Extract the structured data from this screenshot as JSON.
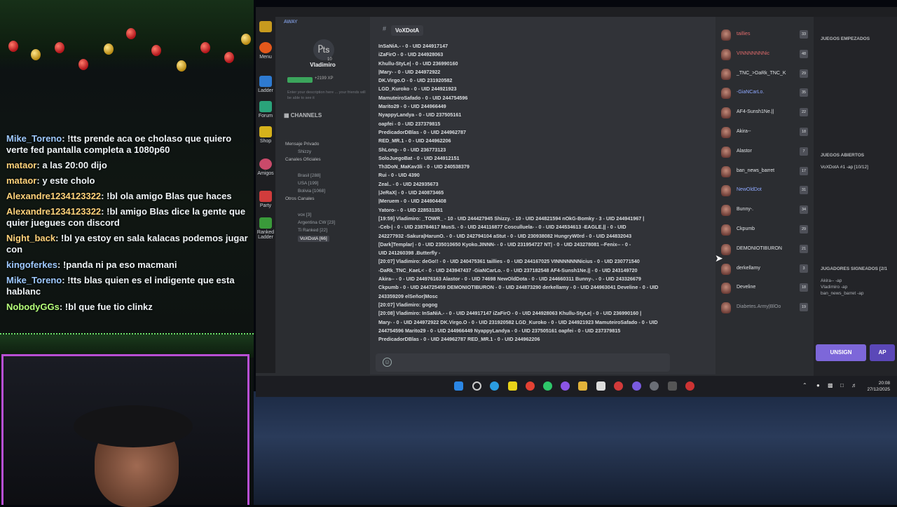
{
  "chat": [
    {
      "user": "Mike_Toreno",
      "color": "#9ec9ff",
      "text": "!tts prende aca oe cholaso que quiero verte fed pantalla completa a 1080p60"
    },
    {
      "user": "mataor",
      "color": "#ffd27a",
      "text": "a las 20:00 dijo"
    },
    {
      "user": "mataor",
      "color": "#ffd27a",
      "text": "y este cholo"
    },
    {
      "user": "Alexandre1234123322",
      "color": "#ffd27a",
      "text": "!bl ola amigo Blas que haces"
    },
    {
      "user": "Alexandre1234123322",
      "color": "#ffd27a",
      "text": "!bl amigo Blas dice la gente que quier juegues con discord"
    },
    {
      "user": "Night_back",
      "color": "#ffd27a",
      "text": "!bl ya estoy en sala kalacas podemos jugar con"
    },
    {
      "user": "kingoferkes",
      "color": "#9ec9ff",
      "text": "!panda ni pa eso macmani"
    },
    {
      "user": "Mike_Toreno",
      "color": "#9ec9ff",
      "text": "!tts blas quien es el indigente que esta hablanc"
    },
    {
      "user": "NobodyGGs",
      "color": "#b6ff7a",
      "text": "!bl que fue tio clinkz"
    }
  ],
  "app": {
    "status": "AWAY",
    "level": "10",
    "username": "Vladimiro",
    "xp": "+2199 XP",
    "description": "Enter your description here ... your friends will be able to see it",
    "channels_label": "CHANNELS",
    "sidebar": [
      "Menu",
      "Ladder",
      "Forum",
      "Shop",
      "Amigos",
      "Party",
      "Ranked Ladder"
    ],
    "tree": [
      {
        "label": "Mensaje Privado",
        "sub": false
      },
      {
        "label": "Shizzy",
        "sub": true
      },
      {
        "label": "Canales Oficiales",
        "sub": false
      },
      {
        "label": "Brasil [288]",
        "sub": true
      },
      {
        "label": "USA [199]",
        "sub": true
      },
      {
        "label": "Bolivia [1068]",
        "sub": true
      },
      {
        "label": "Otros Canales",
        "sub": false
      },
      {
        "label": "vox [3]",
        "sub": true
      },
      {
        "label": "Argentina CW [23]",
        "sub": true
      },
      {
        "label": "Ti Ranked [22]",
        "sub": true
      },
      {
        "label": "VoXDotA [66]",
        "sub": true,
        "selected": true
      }
    ],
    "channel_name": "VoXDotA",
    "messages": [
      "InSaNiA.- - 0 - UID 244917147",
      "iZaFirO - 0 - UID 244928063",
      "Khullu-StyLe| - 0 - UID 236990160",
      "|Mary- - 0 - UID 244972922",
      "DK.Virgo.O - 0 - UID 231920582",
      "LGD_Kuroko - 0 - UID 244921923",
      "MamuteiroSafado - 0 - UID 244754596",
      "Marito29 - 0 - UID 244966449",
      "NyappyLandya - 0 - UID 237505161",
      "oapfei - 0 - UID 237379815",
      "PredicadorDBlas - 0 - UID 244962787",
      "RED_MR.1 - 0 - UID 244962206",
      "ShLong- - 0 - UID 236773123",
      "SoloJuegoBat - 0 - UID 244912151",
      "Th3DoN_MaKav3li - 0 - UID 240538379",
      "Rui - 0 - UID 4390",
      "Zeal.. - 0 - UID 242935673",
      "|JeRaX| - 0 - UID 240873465",
      "|Meruem - 0 - UID 244904408",
      "Yatoro- - 0 - UID 228531351",
      "[19:59] Vladimiro: _TOWR_ - 10 - UID 244427945 Shizzy. - 10 - UID 244821594 nOkG-Bomky - 3 - UID 244941967 |",
      "-Ceb-| - 0 - UID 238784617 MusS. - 0 - UID 244116877 Cosculluela- - 0 - UID 244534613 -EAGLE.|| - 0 - UID",
      "242277932 -Sakura|HarunO. - 0 - UID 242794104 aStut - 0 - UID 230938082 HungryW0rd - 0 - UID 244832043",
      "[Dark]Templar| - 0 - UID 235010650 Kyoko.JINNN- - 0 - UID 231954727 NT| - 0 - UID 243278081 --Fenix-- - 0 -",
      "UID 241260398 .Butterfly -",
      "[20:07] Vladimiro: deGo!! - 0 - UID 240475361 taillies - 0 - UID 244167025 VINNNNNNNicius - 0 - UID 230771540",
      "-DaRk_TNC_KaeL< - 0 - UID 243947437 -GiaNCarLo. - 0 - UID 237182548 AF4-Sunsh1Ne.|| - 0 - UID 243149720",
      "Akira-- - 0 - UID 244976163 Alastor - 0 - UID 74698 NewOldDota - 0 - UID 244660311 Bunny-. - 0 - UID 243326679",
      "Ckpumb - 0 - UID 244725459 DEMONIOTIBURON - 0 - UID 244873290 derkellamy - 0 - UID 244963041 Develine - 0 - UID",
      "243359209 elSeñor|Mosc",
      "[20:07] Vladimiro: gogog",
      "[20:08] Vladimiro: InSaNiA.- - 0 - UID 244917147 iZaFirO - 0 - UID 244928063 Khullu-StyLe| - 0 - UID 236990160 |",
      "Mary- - 0 - UID 244972922 DK.Virgo.O - 0 - UID 231920582 LGD_Kuroko - 0 - UID 244921923 MamuteiroSafado - 0 - UID",
      "244754596 Marito29 - 0 - UID 244966449 NyappyLandya - 0 - UID 237505161 oapfei - 0 - UID 237379815",
      "PredicadorDBlas - 0 - UID 244962787 RED_MR.1 - 0 - UID 244962206"
    ],
    "users": [
      {
        "name": "taillies",
        "lv": "33",
        "color": "#e06b6b"
      },
      {
        "name": "VINNNNNNNic",
        "lv": "48",
        "color": "#e06b6b"
      },
      {
        "name": "_TNC_>DaRk_TNC_K",
        "lv": "29",
        "color": "#e0e3e6"
      },
      {
        "name": "-GiaNCarLo.",
        "lv": "35",
        "color": "#8ea8ff"
      },
      {
        "name": "AF4-Sunsh1Ne.||",
        "lv": "22",
        "color": "#e0e3e6"
      },
      {
        "name": "Akira--",
        "lv": "18",
        "color": "#e0e3e6"
      },
      {
        "name": "Alastor",
        "lv": "7",
        "color": "#e0e3e6"
      },
      {
        "name": "ban_news_barret",
        "lv": "17",
        "color": "#e0e3e6"
      },
      {
        "name": "NewOldDot",
        "lv": "31",
        "color": "#8ea8ff"
      },
      {
        "name": "Bunny-.",
        "lv": "34",
        "color": "#e0e3e6"
      },
      {
        "name": "Ckpumb",
        "lv": "29",
        "color": "#e0e3e6"
      },
      {
        "name": "DEMONIOTIBURON",
        "lv": "21",
        "color": "#e0e3e6"
      },
      {
        "name": "derkellamy",
        "lv": "3",
        "color": "#e0e3e6"
      },
      {
        "name": "Develine",
        "lv": "18",
        "color": "#e0e3e6"
      },
      {
        "name": "Diabetes.Army|BlOo",
        "lv": "19",
        "color": "#9a9ea4"
      }
    ],
    "right_panel": {
      "started_title": "JUEGOS EMPEZADOS",
      "open_title": "JUEGOS ABIERTOS",
      "open_game": "VoXDotA #1 -ap [10/12]",
      "signed_title": "JUGADORES SIGNEADOS [2/1",
      "signed": [
        "Akira-- -ap",
        "Vladimiro -ap",
        "ban_news_barret -ap"
      ]
    },
    "unsign_label": "UNSIGN",
    "ap_label": "AP",
    "clock_time": "20:08",
    "clock_date": "27/12/2025"
  }
}
